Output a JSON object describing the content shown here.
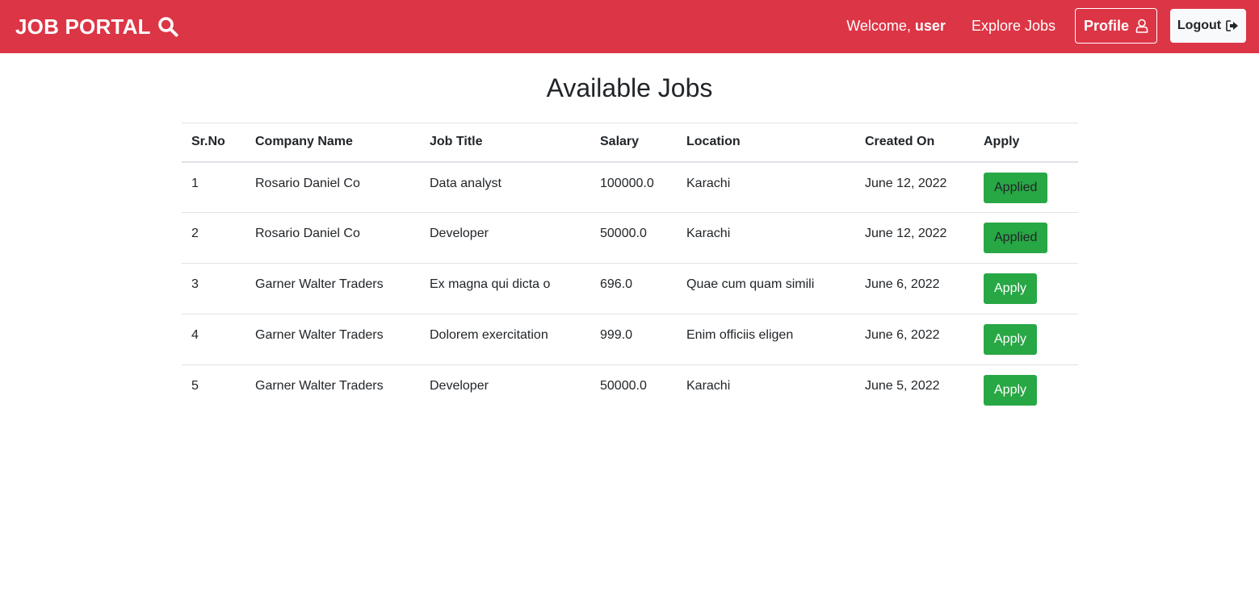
{
  "navbar": {
    "brand": "JOB PORTAL",
    "brand_icon": "search-icon",
    "welcome_prefix": "Welcome, ",
    "username": "user",
    "explore_label": "Explore Jobs",
    "profile_label": "Profile",
    "profile_icon": "user-icon",
    "logout_label": "Logout",
    "logout_icon": "sign-out-icon",
    "bg_color": "#dc3545"
  },
  "page_title": "Available Jobs",
  "table": {
    "headers": [
      "Sr.No",
      "Company Name",
      "Job Title",
      "Salary",
      "Location",
      "Created On",
      "Apply"
    ],
    "rows": [
      {
        "srno": "1",
        "company": "Rosario Daniel Co",
        "title": "Data analyst",
        "salary": "100000.0",
        "location": "Karachi",
        "created": "June 12, 2022",
        "action": "Applied"
      },
      {
        "srno": "2",
        "company": "Rosario Daniel Co",
        "title": "Developer",
        "salary": "50000.0",
        "location": "Karachi",
        "created": "June 12, 2022",
        "action": "Applied"
      },
      {
        "srno": "3",
        "company": "Garner Walter Traders",
        "title": "Ex magna qui dicta o",
        "salary": "696.0",
        "location": "Quae cum quam simili",
        "created": "June 6, 2022",
        "action": "Apply"
      },
      {
        "srno": "4",
        "company": "Garner Walter Traders",
        "title": "Dolorem exercitation",
        "salary": "999.0",
        "location": "Enim officiis eligen",
        "created": "June 6, 2022",
        "action": "Apply"
      },
      {
        "srno": "5",
        "company": "Garner Walter Traders",
        "title": "Developer",
        "salary": "50000.0",
        "location": "Karachi",
        "created": "June 5, 2022",
        "action": "Apply"
      }
    ],
    "action_color": "#28a745"
  }
}
